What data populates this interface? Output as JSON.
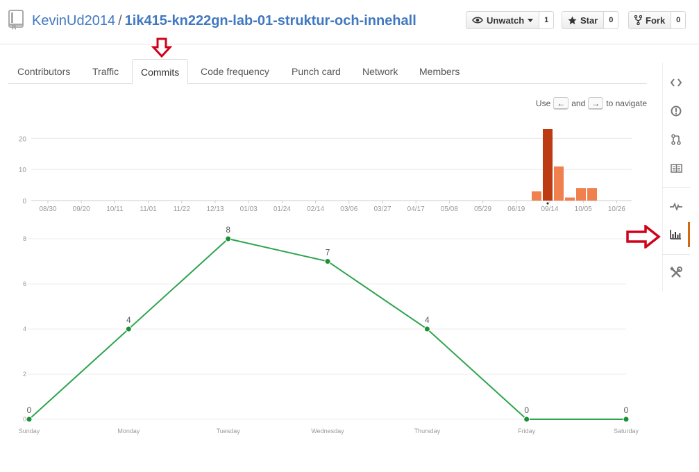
{
  "header": {
    "owner": "KevinUd2014",
    "separator": "/",
    "repo": "1ik415-kn222gn-lab-01-struktur-och-innehall",
    "watch": {
      "label": "Unwatch",
      "count": "1"
    },
    "star": {
      "label": "Star",
      "count": "0"
    },
    "fork": {
      "label": "Fork",
      "count": "0"
    }
  },
  "tabs": [
    {
      "label": "Contributors"
    },
    {
      "label": "Traffic"
    },
    {
      "label": "Commits"
    },
    {
      "label": "Code frequency"
    },
    {
      "label": "Punch card"
    },
    {
      "label": "Network"
    },
    {
      "label": "Members"
    }
  ],
  "active_tab": "Commits",
  "nav_hint": {
    "use": "Use",
    "left_key": "←",
    "and": "and",
    "right_key": "→",
    "suffix": "to navigate"
  },
  "sidebar": {
    "items": [
      {
        "icon": "code-icon"
      },
      {
        "icon": "issues-icon"
      },
      {
        "icon": "pull-request-icon"
      },
      {
        "icon": "wiki-icon"
      },
      {
        "icon": "pulse-icon"
      },
      {
        "icon": "graphs-icon",
        "selected": true
      },
      {
        "icon": "settings-icon"
      }
    ]
  },
  "colors": {
    "bar": "#f0814e",
    "bar_selected": "#bd3b12",
    "line": "#2da44e",
    "point": "#1a9035",
    "selected_indicator": "#d26911",
    "annotation_arrow": "#d0021b",
    "link": "#4078c0"
  },
  "chart_data": [
    {
      "type": "bar",
      "categories": [
        "08/30",
        "09/20",
        "10/11",
        "11/01",
        "11/22",
        "12/13",
        "01/03",
        "01/24",
        "02/14",
        "03/06",
        "03/27",
        "04/17",
        "05/08",
        "05/29",
        "06/19",
        "09/14",
        "10/05",
        "10/26"
      ],
      "weekly_values": [
        3,
        23,
        11,
        1,
        4,
        4
      ],
      "selected_index": 1,
      "ylim": [
        0,
        23
      ],
      "yticks": [
        0,
        10,
        20
      ],
      "grid": true
    },
    {
      "type": "line",
      "categories": [
        "Sunday",
        "Monday",
        "Tuesday",
        "Wednesday",
        "Thursday",
        "Friday",
        "Saturday"
      ],
      "values": [
        0,
        4,
        8,
        7,
        4,
        0,
        0
      ],
      "ylim": [
        0,
        8
      ],
      "yticks": [
        0,
        2,
        4,
        6,
        8
      ],
      "grid": true
    }
  ]
}
